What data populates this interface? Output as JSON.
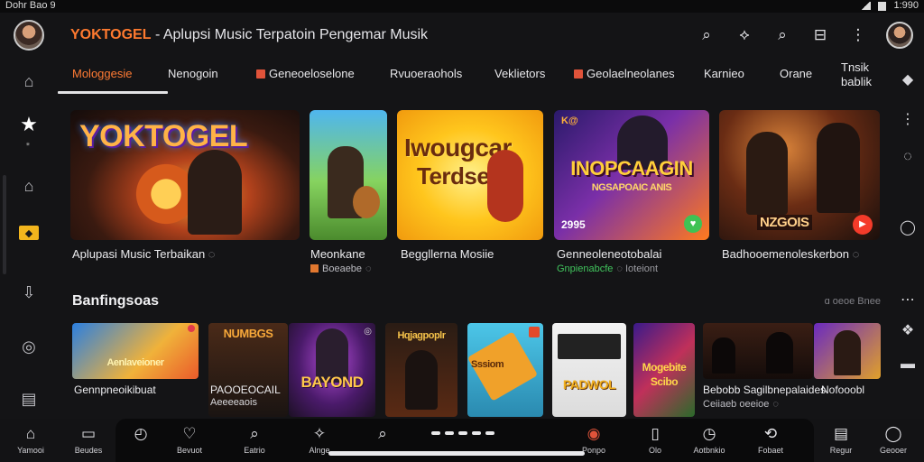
{
  "status": {
    "left": "Dohr Bao 9",
    "right": "1:990"
  },
  "header": {
    "brand_name": "YOKTOGEL",
    "brand_sep": " - ",
    "subtitle": "Aplupsi Music Terpatoin Pengemar Musik",
    "icons": [
      "search-icon",
      "cast-icon",
      "search-icon",
      "library-icon",
      "more-vert-icon"
    ]
  },
  "rail": {
    "items": [
      {
        "icon": "home-icon",
        "glyph": "⌂"
      },
      {
        "icon": "star-icon",
        "glyph": "★",
        "sub": "⁕"
      },
      {
        "icon": "home-outline-icon",
        "glyph": "⌂"
      },
      {
        "icon": "badge-icon",
        "glyph": "◆"
      },
      {
        "icon": "download-icon",
        "glyph": "⇩"
      },
      {
        "icon": "swirl-icon",
        "glyph": "◎"
      },
      {
        "icon": "folder-icon",
        "glyph": "▤"
      }
    ]
  },
  "tabs": [
    {
      "label": "Mologgesie"
    },
    {
      "label": "Nenogoin"
    },
    {
      "label": "Geneoeloselone"
    },
    {
      "label": "Rvuoeraohols"
    },
    {
      "label": "Veklietors"
    },
    {
      "label": "Geolaelneolanes"
    },
    {
      "label": "Karnieo"
    },
    {
      "label": "Orane"
    },
    {
      "label": "Tnsik bablik"
    }
  ],
  "featured": [
    {
      "title": "Aplupasi Music Terbaikan",
      "poster": "YOKTOGEL"
    },
    {
      "title": "Meonkane",
      "sub": "Boeaebe"
    },
    {
      "title": "Beggllerna Mosiie",
      "poster_line1": "Iwougcar",
      "poster_line2": "Terdse"
    },
    {
      "title": "Genneoleneotobalai",
      "sub": "Gnpienabcfe",
      "sub2": "Ioteiont",
      "poster": "INOPCAAGIN",
      "poster_sub": "NGSAPOAIC ANIS",
      "corner": "K@",
      "badge": "2995"
    },
    {
      "title": "Badhooemenoleskerbon",
      "poster": "NZGOIS"
    }
  ],
  "section": {
    "title": "Banfingsoas",
    "more": "ɑ oeoe Bnee"
  },
  "tiles": [
    {
      "title": "Gennpneoikibuat",
      "poster": "Aenlaveioner"
    },
    {
      "title": "PAOOEOCAIL",
      "sub": "Aeeeeaois",
      "poster": "NUMBGS"
    },
    {
      "poster": "BAYOND"
    },
    {
      "poster": "Hqjagpoplr"
    },
    {
      "poster": "Sssiom"
    },
    {
      "poster": "PADWOL"
    },
    {
      "poster_line1": "Mogebite",
      "poster_line2": "Scibo"
    },
    {
      "title": "Bebobb Sagilbnepalaides",
      "sub": "Ceiiaeb oeeioe"
    },
    {
      "title": "Nofooobl"
    }
  ],
  "bottom_nav": [
    {
      "label": "Yamooi",
      "glyph": "⌂",
      "icon": "home-icon"
    },
    {
      "label": "Beudes",
      "glyph": "▭",
      "icon": "browse-icon"
    },
    {
      "label": "",
      "glyph": "◴",
      "icon": "discover-icon"
    },
    {
      "label": "Bevuot",
      "glyph": "♡",
      "icon": "heart-icon"
    },
    {
      "label": "Eatrio",
      "glyph": "⌕",
      "icon": "search-icon"
    },
    {
      "label": "Alnge",
      "glyph": "✧",
      "icon": "sparkle-icon"
    },
    {
      "label": "",
      "glyph": "⌕",
      "icon": "search-small-icon"
    },
    {
      "label": "Ponpo",
      "glyph": "◉",
      "icon": "record-icon"
    },
    {
      "label": "Olo",
      "glyph": "▯",
      "icon": "device-icon"
    },
    {
      "label": "Aotbnkio",
      "glyph": "◷",
      "icon": "clock-icon"
    },
    {
      "label": "Fobaet",
      "glyph": "⟲",
      "icon": "history-icon"
    },
    {
      "label": "Regur",
      "glyph": "▤",
      "icon": "library-icon"
    },
    {
      "label": "Geooer",
      "glyph": "◯",
      "icon": "account-icon"
    }
  ]
}
